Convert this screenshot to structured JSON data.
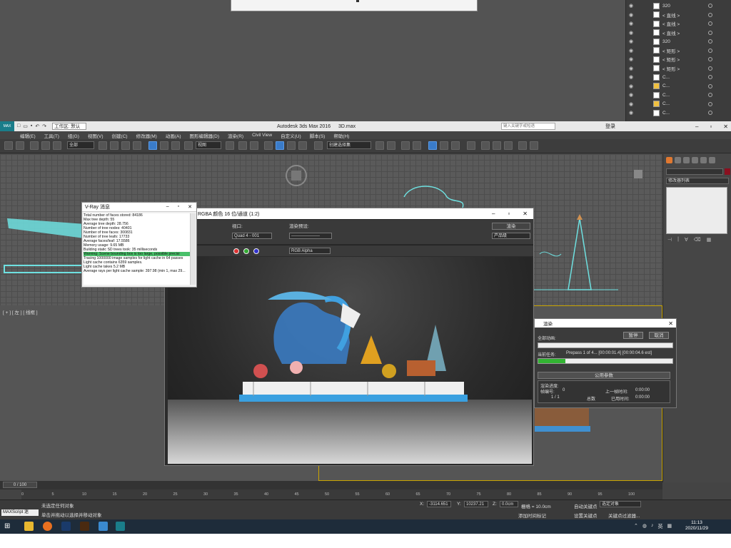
{
  "layers": [
    {
      "name": "320",
      "swatch": "white"
    },
    {
      "name": "< 直线 >",
      "swatch": "white"
    },
    {
      "name": "< 直线 >",
      "swatch": "white"
    },
    {
      "name": "< 直线 >",
      "swatch": "white"
    },
    {
      "name": "320",
      "swatch": "white"
    },
    {
      "name": "< 矩形 >",
      "swatch": "white"
    },
    {
      "name": "< 矩形 >",
      "swatch": "white"
    },
    {
      "name": "< 矩形 >",
      "swatch": "white"
    },
    {
      "name": "C...",
      "swatch": "white"
    },
    {
      "name": "C...",
      "swatch": "orange"
    },
    {
      "name": "C...",
      "swatch": "white"
    },
    {
      "name": "C...",
      "swatch": "orange"
    },
    {
      "name": "C...",
      "swatch": "white"
    }
  ],
  "titlebar": {
    "workspace_label": "工作区: 默认",
    "app_title": "Autodesk 3ds Max 2016",
    "file_name": "3D.max",
    "search_placeholder": "键入关键字或短语",
    "login": "登录"
  },
  "menu": [
    "编辑(E)",
    "工具(T)",
    "组(G)",
    "视图(V)",
    "创建(C)",
    "修改器(M)",
    "动画(A)",
    "图形编辑器(D)",
    "渲染(R)",
    "Civil View",
    "自定义(U)",
    "脚本(S)",
    "帮助(H)"
  ],
  "toolbar": {
    "filter_select": "全部",
    "view_select": "视图",
    "selection_set": "创建选择集"
  },
  "viewport": {
    "label": "[ + ] [ 左 ] [ 线框 ]"
  },
  "cmdpanel": {
    "modifier_list": "修改器列表"
  },
  "vray": {
    "title": "V-Ray 消息",
    "lines": [
      "Total number of faces stored: 84186",
      "Max tree depth: 55",
      "Average tree depth: 28.756",
      "Number of tree nodes: 40401",
      "Number of tree faces: 300831",
      "Number of tree leafs: 17733",
      "Average faces/leaf: 17.5586",
      "Memory usage: 9.65 MB",
      "Building static SD trees took: 35 milliseconds",
      "Warning: Scene bounding box is too large, possible precisi",
      "Tracing 1000000 image samples for light cache in 64 passes",
      "Light cache contains 6359 samples.",
      "Light cache takes 5.2 MB",
      "Average rays per light cache sample: 397.98 (min 1, max 29..."
    ],
    "warning_index": 9
  },
  "framebuffer": {
    "title": "RGBA 颜色 16 位/通道 (1:2)",
    "viewport_label": "视口:",
    "viewport_value": "Quad 4 - 001",
    "preset_label": "渲染预设:",
    "preset_value": "--------------------",
    "render_button": "渲染",
    "product_value": "产品级",
    "channel_value": "RGB Alpha"
  },
  "progress": {
    "title": "渲染",
    "total_label": "全部动画:",
    "pause": "暂停",
    "cancel": "取消",
    "current_label": "当前任务:",
    "current_task": "Prepass 1 of 4... [00:00:01.4] [00:00:04.6 est]",
    "progress_fraction": 0.2,
    "section": "公用参数",
    "render_progress": "渲染进度:",
    "frame_no": "帧编号:",
    "frame_val": "0",
    "last_frame_time": "上一帧时间:",
    "last_time_val": "0:00:00",
    "frame_count": "1 / 1",
    "total": "总数",
    "elapsed": "已用时间:",
    "elapsed_val": "0:00:00"
  },
  "timeline": {
    "frame": "0 / 100",
    "ticks": [
      "0",
      "5",
      "10",
      "15",
      "20",
      "25",
      "30",
      "35",
      "40",
      "45",
      "50",
      "55",
      "60",
      "65",
      "70",
      "75",
      "80",
      "85",
      "90",
      "95",
      "100"
    ]
  },
  "status": {
    "maxscript": "MAXScript 迷",
    "line1": "未选定任何对象",
    "line2": "单击并拖动以选择并移动对象",
    "x_value": "-3114.651",
    "y_value": "10237.21",
    "z_value": "0.0cm",
    "grid": "栅格 = 10.0cm",
    "add_tag": "添加时间标记",
    "auto_key": "自动关键点",
    "sel_obj": "选定对象",
    "set_key": "设置关键点",
    "key_filter": "关键点过滤器..."
  },
  "taskbar": {
    "time": "11:13",
    "date": "2020/11/29",
    "ime": "英"
  }
}
